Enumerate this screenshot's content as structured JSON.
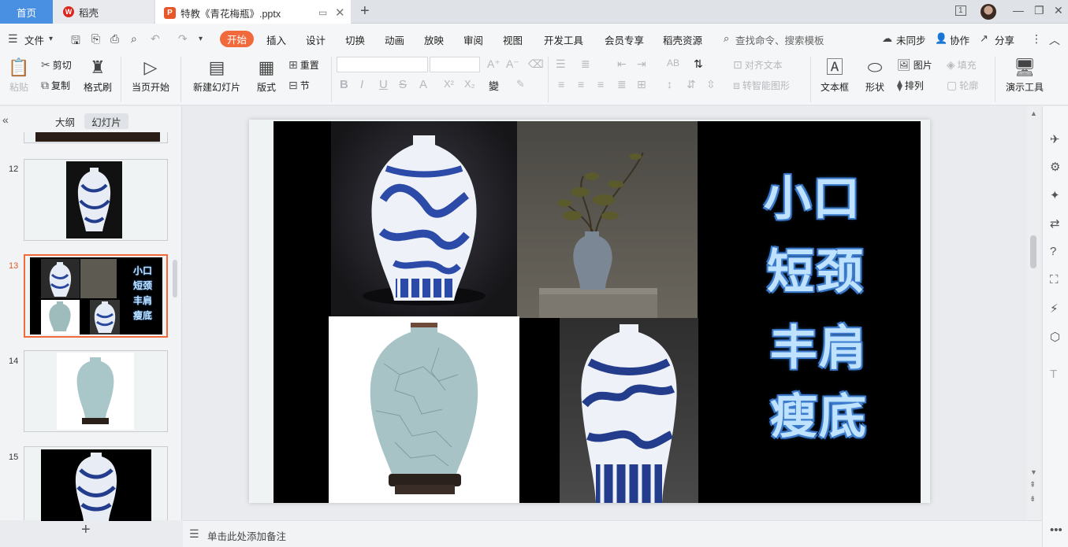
{
  "tabs": {
    "home": "首页",
    "daoke": "稻壳",
    "doc_title": "特教《青花梅瓶》.pptx"
  },
  "window": {
    "page_indicator": "1"
  },
  "menu": {
    "file": "文件",
    "items": [
      "开始",
      "插入",
      "设计",
      "切换",
      "动画",
      "放映",
      "审阅",
      "视图",
      "开发工具",
      "会员专享",
      "稻壳资源"
    ],
    "search_placeholder": "查找命令、搜索模板",
    "unsynced": "未同步",
    "collaborate": "协作",
    "share": "分享"
  },
  "ribbon": {
    "paste": "粘贴",
    "cut": "剪切",
    "copy": "复制",
    "format_painter": "格式刷",
    "from_current": "当页开始",
    "new_slide": "新建幻灯片",
    "layout": "版式",
    "reset": "重置",
    "section": "节",
    "align_text": "对齐文本",
    "smart_shape": "转智能图形",
    "textbox": "文本框",
    "shape": "形状",
    "picture": "图片",
    "arrange": "排列",
    "fill": "填充",
    "outline": "轮廓",
    "presentation_tools": "演示工具",
    "font_family_value": "",
    "font_size_value": ""
  },
  "left_pane": {
    "tab_outline": "大纲",
    "tab_slides": "幻灯片",
    "slide_numbers": [
      "12",
      "13",
      "14",
      "15"
    ],
    "add": "+"
  },
  "slide": {
    "title_lines": [
      "小口",
      "短颈",
      "丰肩",
      "瘦底"
    ],
    "thumb_lines": [
      "小口",
      "短颈",
      "丰肩",
      "瘦底"
    ]
  },
  "status": {
    "notes_placeholder": "单击此处添加备注"
  },
  "colors": {
    "accent": "#f06a3c",
    "home_tab": "#4a90e2",
    "selected_border": "#f06a3c",
    "slide_text": "#bfe3ff"
  }
}
